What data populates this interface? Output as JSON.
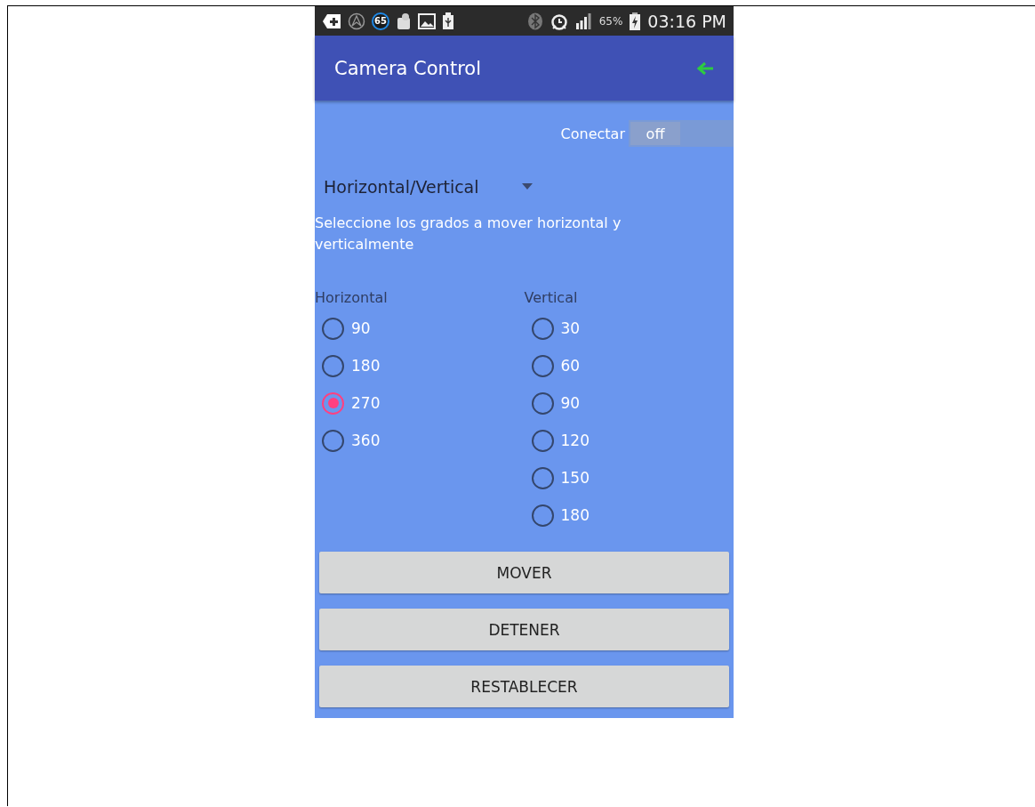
{
  "status_bar": {
    "badge": "65",
    "battery": "65%",
    "time": "03:16 PM"
  },
  "app_bar": {
    "title": "Camera Control"
  },
  "connect": {
    "label": "Conectar",
    "state_text": "off",
    "on": false
  },
  "dropdown": {
    "value": "Horizontal/Vertical"
  },
  "instructions": "Seleccione los grados a mover horizontal y verticalmente",
  "radio_groups": [
    {
      "title": "Horizontal",
      "options": [
        {
          "label": "90",
          "selected": false
        },
        {
          "label": "180",
          "selected": false
        },
        {
          "label": "270",
          "selected": true
        },
        {
          "label": "360",
          "selected": false
        }
      ]
    },
    {
      "title": "Vertical",
      "options": [
        {
          "label": "30",
          "selected": false
        },
        {
          "label": "60",
          "selected": false
        },
        {
          "label": "90",
          "selected": false
        },
        {
          "label": "120",
          "selected": false
        },
        {
          "label": "150",
          "selected": false
        },
        {
          "label": "180",
          "selected": false
        }
      ]
    }
  ],
  "buttons": [
    "MOVER",
    "DETENER",
    "RESTABLECER"
  ]
}
